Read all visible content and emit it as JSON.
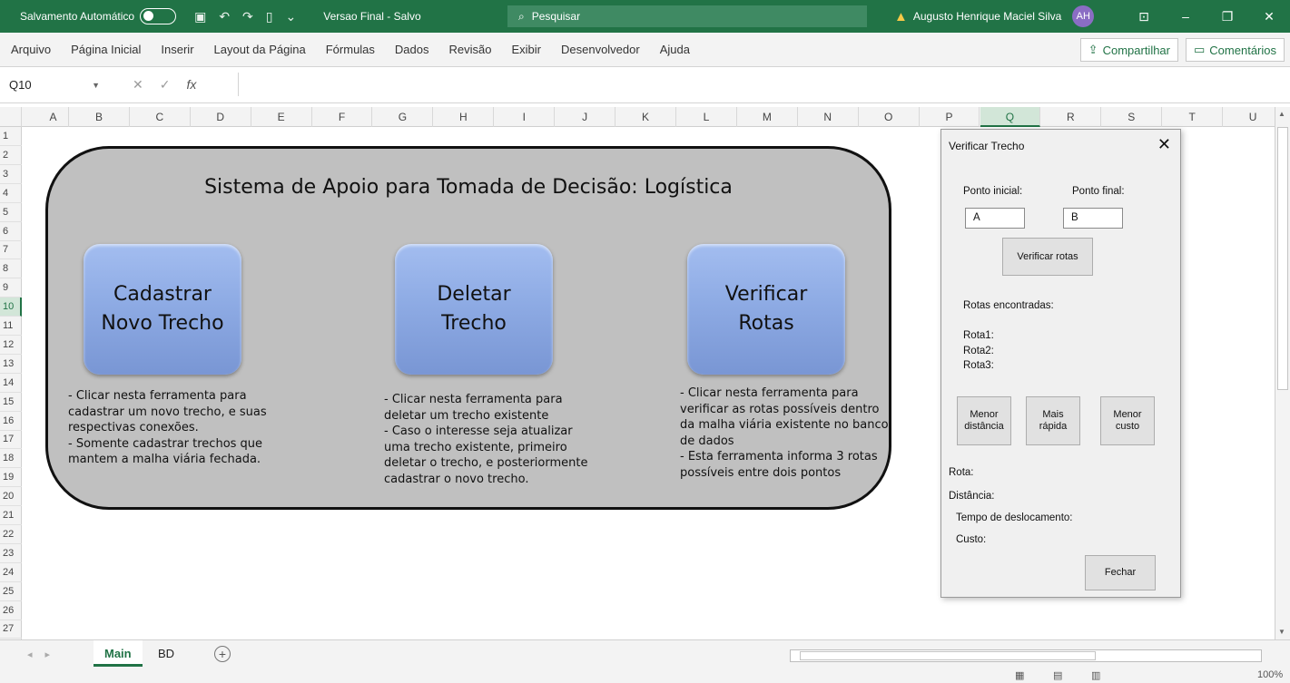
{
  "titlebar": {
    "autosave_label": "Salvamento Automático",
    "autosave_state": "Desativado",
    "document": "Versao Final - Salvo",
    "search_placeholder": "Pesquisar",
    "user_name": "Augusto Henrique Maciel Silva",
    "user_initials": "AH"
  },
  "ribbon": {
    "tabs": [
      "Arquivo",
      "Página Inicial",
      "Inserir",
      "Layout da Página",
      "Fórmulas",
      "Dados",
      "Revisão",
      "Exibir",
      "Desenvolvedor",
      "Ajuda"
    ],
    "share_label": "Compartilhar",
    "comments_label": "Comentários"
  },
  "formula_bar": {
    "name_box": "Q10",
    "fx": "fx",
    "value": ""
  },
  "grid": {
    "columns": [
      "A",
      "B",
      "C",
      "D",
      "E",
      "F",
      "G",
      "H",
      "I",
      "J",
      "K",
      "L",
      "M",
      "N",
      "O",
      "P",
      "Q",
      "R",
      "S",
      "T",
      "U"
    ],
    "rows": [
      "1",
      "2",
      "3",
      "4",
      "5",
      "6",
      "7",
      "8",
      "9",
      "10",
      "11",
      "12",
      "13",
      "14",
      "15",
      "16",
      "17",
      "18",
      "19",
      "20",
      "21",
      "22",
      "23",
      "24",
      "25",
      "26",
      "27"
    ],
    "selected_column": "Q",
    "selected_row": "10"
  },
  "panel": {
    "title": "Sistema de Apoio para Tomada de Decisão: Logística",
    "buttons": [
      {
        "label": "Cadastrar\nNovo Trecho",
        "description": "- Clicar nesta ferramenta para\ncadastrar um novo trecho, e suas\nrespectivas conexões.\n- Somente cadastrar trechos que\nmantem a malha viária fechada."
      },
      {
        "label": "Deletar\nTrecho",
        "description": "- Clicar nesta ferramenta para\ndeletar um trecho existente\n- Caso o interesse seja atualizar\numa trecho existente, primeiro\ndeletar o trecho, e posteriormente\ncadastrar o novo trecho."
      },
      {
        "label": "Verificar\nRotas",
        "description": "- Clicar nesta ferramenta para\nverificar as rotas possíveis dentro\nda malha viária existente no banco\nde dados\n- Esta ferramenta informa 3 rotas\npossíveis entre dois pontos"
      }
    ]
  },
  "dialog": {
    "title": "Verificar Trecho",
    "start_label": "Ponto inicial:",
    "end_label": "Ponto final:",
    "start_value": "A",
    "end_value": "B",
    "verify_button": "Verificar rotas",
    "routes_found_label": "Rotas encontradas:",
    "routes": [
      "Rota1:",
      "Rota2:",
      "Rota3:"
    ],
    "option_buttons": [
      "Menor\ndistância",
      "Mais\nrápida",
      "Menor\ncusto"
    ],
    "result_labels": [
      "Rota:",
      "Distância:",
      "Tempo de deslocamento:",
      "Custo:"
    ],
    "close_button": "Fechar"
  },
  "sheet_tabs": [
    "Main",
    "BD"
  ],
  "active_sheet": "Main",
  "status": {
    "zoom": "100%"
  }
}
